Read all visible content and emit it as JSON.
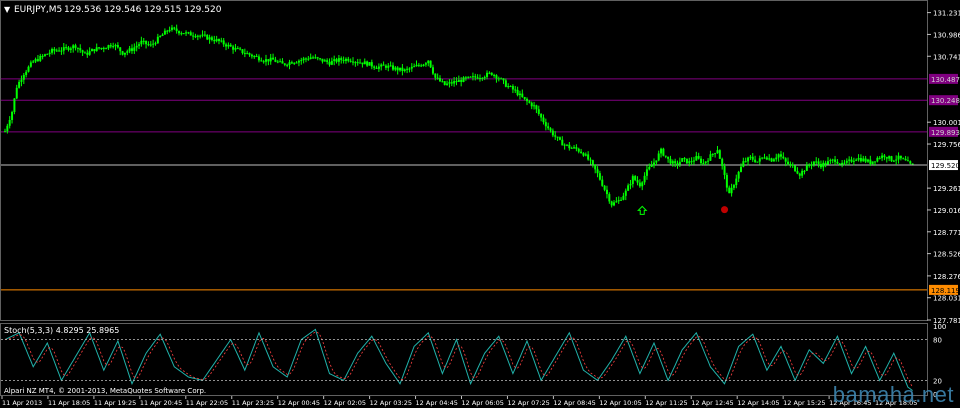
{
  "header": {
    "symbol": "EURJPY,M5",
    "ohlc": "129.536 129.546 129.515 129.520"
  },
  "price_axis": {
    "ticks": [
      "131.231",
      "130.986",
      "130.741",
      "130.001",
      "129.756",
      "129.261",
      "129.016",
      "128.771",
      "128.526",
      "128.276",
      "128.031",
      "127.781"
    ],
    "labels": [
      {
        "text": "130.487",
        "value": 130.487,
        "color": "#800080"
      },
      {
        "text": "130.248",
        "value": 130.248,
        "color": "#800080"
      },
      {
        "text": "129.893",
        "value": 129.893,
        "color": "#800080"
      },
      {
        "text": "129.520",
        "value": 129.52,
        "color": "#ffffff"
      },
      {
        "text": "128.119",
        "value": 128.119,
        "color": "#ff8c00"
      }
    ]
  },
  "indicator": {
    "label": "Stoch(5,3,3) 4.8295 25.8965",
    "levels": [
      "100",
      "80",
      "20",
      "0"
    ],
    "credit": "Alpari NZ MT4, © 2001-2013, MetaQuotes Software Corp."
  },
  "time_axis": {
    "labels": [
      "11 Apr 2013",
      "11 Apr 18:05",
      "11 Apr 19:25",
      "11 Apr 20:45",
      "11 Apr 22:05",
      "11 Apr 23:25",
      "12 Apr 00:45",
      "12 Apr 02:05",
      "12 Apr 03:25",
      "12 Apr 04:45",
      "12 Apr 06:05",
      "12 Apr 07:25",
      "12 Apr 08:45",
      "12 Apr 10:05",
      "12 Apr 11:25",
      "12 Apr 12:45",
      "12 Apr 14:05",
      "12 Apr 15:25",
      "12 Apr 16:45",
      "12 Apr 18:05"
    ]
  },
  "watermark": "bamaha.net",
  "colors": {
    "candle": "#00ff00",
    "grid_purple": "#800080",
    "bid_line": "#c0c0c0",
    "orange_line": "#ff8c00",
    "stoch_main": "#20b2aa",
    "stoch_signal": "#ff4040",
    "axis": "#c0c0c0"
  },
  "chart_data": {
    "type": "candlestick",
    "ylim": [
      127.781,
      131.35
    ],
    "stoch_ylim": [
      0,
      100
    ],
    "close_path": [
      [
        0,
        129.9
      ],
      [
        3,
        130.12
      ],
      [
        5,
        130.4
      ],
      [
        8,
        130.55
      ],
      [
        12,
        130.68
      ],
      [
        16,
        130.74
      ],
      [
        20,
        130.8
      ],
      [
        25,
        130.82
      ],
      [
        30,
        130.86
      ],
      [
        34,
        130.76
      ],
      [
        38,
        130.82
      ],
      [
        42,
        130.84
      ],
      [
        46,
        130.88
      ],
      [
        50,
        130.78
      ],
      [
        54,
        130.82
      ],
      [
        58,
        130.9
      ],
      [
        62,
        130.86
      ],
      [
        66,
        130.96
      ],
      [
        70,
        131.05
      ],
      [
        74,
        131.02
      ],
      [
        78,
        130.99
      ],
      [
        82,
        130.98
      ],
      [
        86,
        130.95
      ],
      [
        90,
        130.92
      ],
      [
        94,
        130.87
      ],
      [
        98,
        130.82
      ],
      [
        102,
        130.78
      ],
      [
        106,
        130.74
      ],
      [
        110,
        130.7
      ],
      [
        114,
        130.7
      ],
      [
        118,
        130.65
      ],
      [
        122,
        130.68
      ],
      [
        126,
        130.7
      ],
      [
        130,
        130.73
      ],
      [
        134,
        130.7
      ],
      [
        138,
        130.67
      ],
      [
        142,
        130.7
      ],
      [
        146,
        130.71
      ],
      [
        150,
        130.68
      ],
      [
        154,
        130.66
      ],
      [
        158,
        130.62
      ],
      [
        162,
        130.63
      ],
      [
        166,
        130.6
      ],
      [
        170,
        130.58
      ],
      [
        174,
        130.62
      ],
      [
        178,
        130.66
      ],
      [
        180,
        130.7
      ],
      [
        183,
        130.5
      ],
      [
        187,
        130.42
      ],
      [
        191,
        130.45
      ],
      [
        195,
        130.48
      ],
      [
        199,
        130.5
      ],
      [
        203,
        130.52
      ],
      [
        207,
        130.55
      ],
      [
        210,
        130.5
      ],
      [
        213,
        130.42
      ],
      [
        217,
        130.35
      ],
      [
        221,
        130.25
      ],
      [
        225,
        130.18
      ],
      [
        228,
        130.05
      ],
      [
        232,
        129.9
      ],
      [
        236,
        129.78
      ],
      [
        240,
        129.72
      ],
      [
        243,
        129.7
      ],
      [
        246,
        129.65
      ],
      [
        249,
        129.55
      ],
      [
        252,
        129.42
      ],
      [
        255,
        129.25
      ],
      [
        258,
        129.08
      ],
      [
        261,
        129.12
      ],
      [
        264,
        129.22
      ],
      [
        267,
        129.38
      ],
      [
        270,
        129.3
      ],
      [
        273,
        129.45
      ],
      [
        276,
        129.55
      ],
      [
        279,
        129.68
      ],
      [
        282,
        129.58
      ],
      [
        285,
        129.52
      ],
      [
        288,
        129.58
      ],
      [
        291,
        129.55
      ],
      [
        294,
        129.6
      ],
      [
        297,
        129.54
      ],
      [
        300,
        129.62
      ],
      [
        303,
        129.7
      ],
      [
        305,
        129.5
      ],
      [
        308,
        129.18
      ],
      [
        311,
        129.38
      ],
      [
        314,
        129.55
      ],
      [
        317,
        129.6
      ],
      [
        320,
        129.56
      ],
      [
        323,
        129.62
      ],
      [
        326,
        129.58
      ],
      [
        329,
        129.64
      ],
      [
        332,
        129.55
      ],
      [
        335,
        129.5
      ],
      [
        338,
        129.42
      ],
      [
        341,
        129.5
      ],
      [
        344,
        129.56
      ],
      [
        347,
        129.52
      ],
      [
        350,
        129.55
      ],
      [
        353,
        129.58
      ],
      [
        356,
        129.52
      ],
      [
        359,
        129.56
      ],
      [
        362,
        129.6
      ],
      [
        365,
        129.58
      ],
      [
        368,
        129.55
      ],
      [
        371,
        129.6
      ],
      [
        374,
        129.63
      ],
      [
        377,
        129.58
      ],
      [
        380,
        129.6
      ],
      [
        383,
        129.56
      ],
      [
        385,
        129.52
      ]
    ],
    "stoch_path": [
      [
        0,
        80
      ],
      [
        6,
        90
      ],
      [
        12,
        40
      ],
      [
        18,
        75
      ],
      [
        24,
        20
      ],
      [
        30,
        55
      ],
      [
        36,
        90
      ],
      [
        42,
        35
      ],
      [
        48,
        78
      ],
      [
        54,
        15
      ],
      [
        60,
        60
      ],
      [
        66,
        88
      ],
      [
        72,
        40
      ],
      [
        78,
        25
      ],
      [
        84,
        20
      ],
      [
        90,
        50
      ],
      [
        96,
        80
      ],
      [
        102,
        35
      ],
      [
        108,
        90
      ],
      [
        114,
        40
      ],
      [
        120,
        25
      ],
      [
        126,
        80
      ],
      [
        132,
        95
      ],
      [
        138,
        30
      ],
      [
        144,
        20
      ],
      [
        150,
        60
      ],
      [
        156,
        85
      ],
      [
        162,
        45
      ],
      [
        168,
        15
      ],
      [
        174,
        70
      ],
      [
        180,
        90
      ],
      [
        186,
        30
      ],
      [
        192,
        80
      ],
      [
        198,
        15
      ],
      [
        204,
        60
      ],
      [
        210,
        85
      ],
      [
        216,
        30
      ],
      [
        222,
        78
      ],
      [
        228,
        20
      ],
      [
        234,
        55
      ],
      [
        240,
        90
      ],
      [
        246,
        35
      ],
      [
        252,
        20
      ],
      [
        258,
        50
      ],
      [
        264,
        85
      ],
      [
        270,
        30
      ],
      [
        276,
        75
      ],
      [
        282,
        20
      ],
      [
        288,
        65
      ],
      [
        294,
        90
      ],
      [
        300,
        40
      ],
      [
        306,
        15
      ],
      [
        312,
        70
      ],
      [
        318,
        88
      ],
      [
        324,
        35
      ],
      [
        330,
        70
      ],
      [
        336,
        20
      ],
      [
        342,
        65
      ],
      [
        348,
        45
      ],
      [
        354,
        85
      ],
      [
        360,
        30
      ],
      [
        366,
        70
      ],
      [
        372,
        20
      ],
      [
        378,
        60
      ],
      [
        384,
        10
      ],
      [
        386,
        5
      ]
    ],
    "arrows": [
      {
        "index": 271,
        "price": 129.0,
        "kind": "up",
        "color": "#00ff00"
      },
      {
        "index": 306,
        "price": 129.02,
        "kind": "dot",
        "color": "#c00000"
      }
    ]
  }
}
